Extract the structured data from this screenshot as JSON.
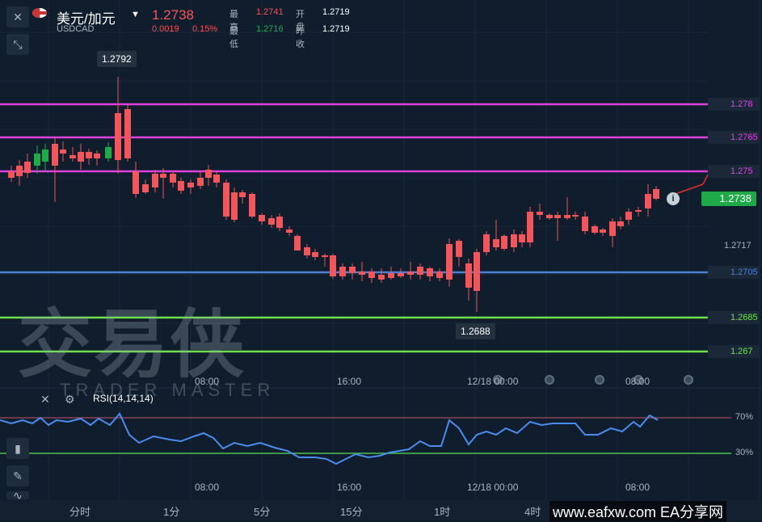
{
  "instrument": {
    "name": "美元/加元",
    "code": "USDCAD",
    "price": "1.2738",
    "change": "0.0019",
    "change_pct": "0.15%",
    "high_label": "最高",
    "high": "1.2741",
    "low_label": "最低",
    "low": "1.2716",
    "open_label": "开盘",
    "open": "1.2719",
    "prev_label": "昨收",
    "prev": "1.2719"
  },
  "levels": [
    {
      "value": "1.278",
      "color": "#e040e0"
    },
    {
      "value": "1.2765",
      "color": "#e040e0"
    },
    {
      "value": "1.275",
      "color": "#e040e0"
    },
    {
      "value": "1.2705",
      "color": "#4a7fd6"
    },
    {
      "value": "1.2685",
      "color": "#6fe04a"
    },
    {
      "value": "1.267",
      "color": "#6fe04a"
    }
  ],
  "current_price_tag": "1.2738",
  "axis_mid_label": "1.2717",
  "tooltips": {
    "high_point": "1.2792",
    "low_point": "1.2688"
  },
  "watermark": {
    "main": "交易侠",
    "sub": "TRADER MASTER"
  },
  "x_labels": [
    "08:00",
    "16:00",
    "12/18 00:00",
    "08:00"
  ],
  "rsi": {
    "label": "RSI(14,14,14)",
    "upper": "70%",
    "lower": "30%"
  },
  "timeframes": [
    "分时",
    "1分",
    "5分",
    "15分",
    "1时",
    "4时"
  ],
  "brand": "www.eafxw.com  EA分享网",
  "colors": {
    "up": "#1faa4a",
    "down": "#f2555a",
    "rsi_line": "#4a8cf0"
  }
}
